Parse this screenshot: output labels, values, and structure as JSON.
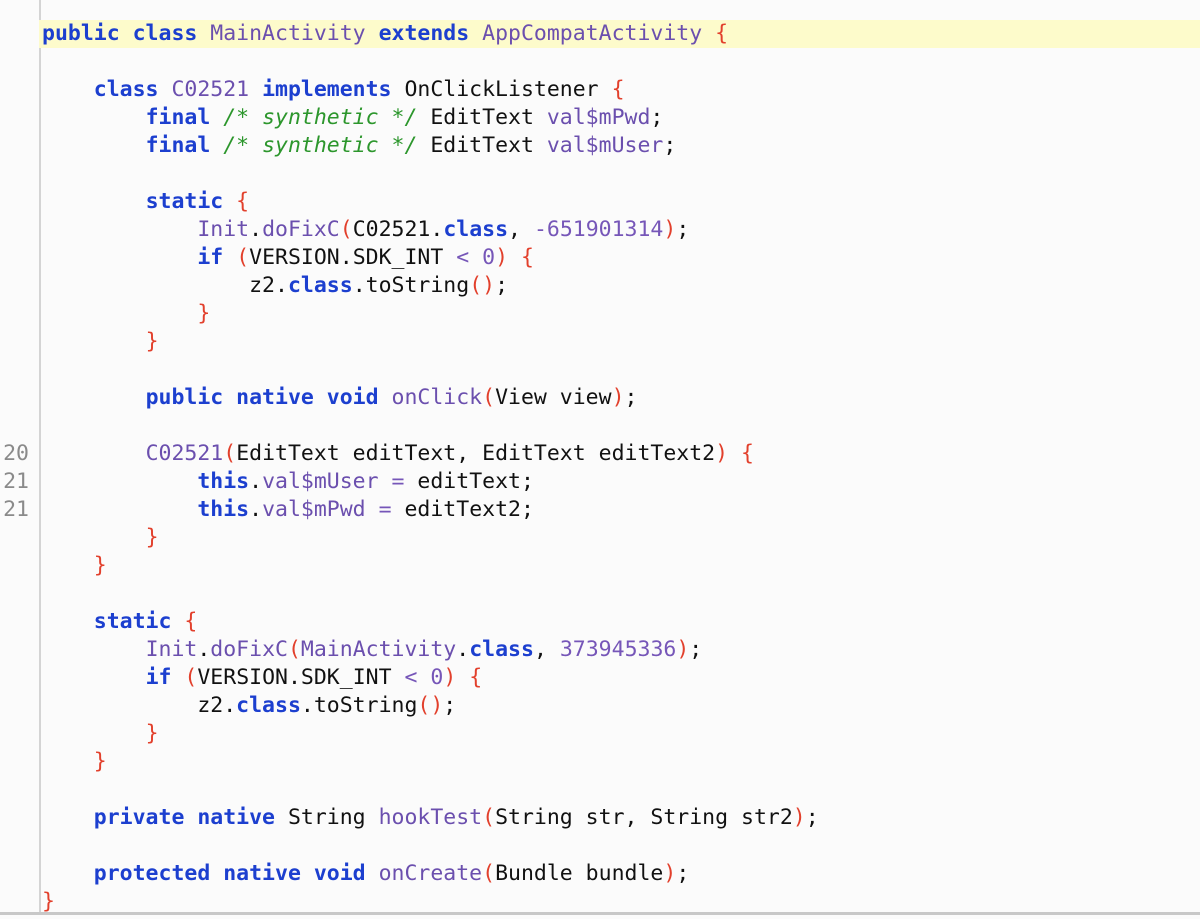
{
  "theme": {
    "keyword": "#1c3fcf",
    "identifier": "#6b4fae",
    "punctuation": "#e2402c",
    "comment": "#2c962c",
    "highlight": "#fdfbcb"
  },
  "code": {
    "highlighted_line": 0,
    "lines": [
      {
        "num": "",
        "tokens": [
          [
            "k",
            "public class "
          ],
          [
            "t",
            "MainActivity "
          ],
          [
            "k",
            "extends "
          ],
          [
            "t",
            "AppCompatActivity "
          ],
          [
            "p",
            "{"
          ]
        ]
      },
      {
        "num": "",
        "tokens": []
      },
      {
        "num": "",
        "tokens": [
          [
            "n",
            "    "
          ],
          [
            "k",
            "class "
          ],
          [
            "t",
            "C02521 "
          ],
          [
            "k",
            "implements "
          ],
          [
            "n",
            "OnClickListener "
          ],
          [
            "p",
            "{"
          ]
        ]
      },
      {
        "num": "",
        "tokens": [
          [
            "n",
            "        "
          ],
          [
            "k",
            "final "
          ],
          [
            "c",
            "/* synthetic */ "
          ],
          [
            "n",
            "EditText "
          ],
          [
            "t",
            "val$mPwd"
          ],
          [
            "n",
            ";"
          ]
        ]
      },
      {
        "num": "",
        "tokens": [
          [
            "n",
            "        "
          ],
          [
            "k",
            "final "
          ],
          [
            "c",
            "/* synthetic */ "
          ],
          [
            "n",
            "EditText "
          ],
          [
            "t",
            "val$mUser"
          ],
          [
            "n",
            ";"
          ]
        ]
      },
      {
        "num": "",
        "tokens": []
      },
      {
        "num": "",
        "tokens": [
          [
            "n",
            "        "
          ],
          [
            "k",
            "static "
          ],
          [
            "p",
            "{"
          ]
        ]
      },
      {
        "num": "",
        "tokens": [
          [
            "n",
            "            "
          ],
          [
            "t",
            "Init"
          ],
          [
            "n",
            "."
          ],
          [
            "t",
            "doFixC"
          ],
          [
            "p",
            "("
          ],
          [
            "n",
            "C02521."
          ],
          [
            "k",
            "class"
          ],
          [
            "n",
            ", "
          ],
          [
            "o",
            "-651901314"
          ],
          [
            "p",
            ")"
          ],
          [
            "n",
            ";"
          ]
        ]
      },
      {
        "num": "",
        "tokens": [
          [
            "n",
            "            "
          ],
          [
            "k",
            "if "
          ],
          [
            "p",
            "("
          ],
          [
            "n",
            "VERSION.SDK_INT "
          ],
          [
            "o",
            "< 0"
          ],
          [
            "p",
            ") {"
          ]
        ]
      },
      {
        "num": "",
        "tokens": [
          [
            "n",
            "                z2."
          ],
          [
            "k",
            "class"
          ],
          [
            "n",
            ".toString"
          ],
          [
            "p",
            "()"
          ],
          [
            "n",
            ";"
          ]
        ]
      },
      {
        "num": "",
        "tokens": [
          [
            "n",
            "            "
          ],
          [
            "p",
            "}"
          ]
        ]
      },
      {
        "num": "",
        "tokens": [
          [
            "n",
            "        "
          ],
          [
            "p",
            "}"
          ]
        ]
      },
      {
        "num": "",
        "tokens": []
      },
      {
        "num": "",
        "tokens": [
          [
            "n",
            "        "
          ],
          [
            "k",
            "public native void "
          ],
          [
            "t",
            "onClick"
          ],
          [
            "p",
            "("
          ],
          [
            "n",
            "View view"
          ],
          [
            "p",
            ")"
          ],
          [
            "n",
            ";"
          ]
        ]
      },
      {
        "num": "",
        "tokens": []
      },
      {
        "num": "20",
        "tokens": [
          [
            "n",
            "        "
          ],
          [
            "t",
            "C02521"
          ],
          [
            "p",
            "("
          ],
          [
            "n",
            "EditText editText, EditText editText2"
          ],
          [
            "p",
            ") {"
          ]
        ]
      },
      {
        "num": "21",
        "tokens": [
          [
            "n",
            "            "
          ],
          [
            "k",
            "this"
          ],
          [
            "n",
            "."
          ],
          [
            "t",
            "val$mUser "
          ],
          [
            "o",
            "= "
          ],
          [
            "n",
            "editText;"
          ]
        ]
      },
      {
        "num": "21",
        "tokens": [
          [
            "n",
            "            "
          ],
          [
            "k",
            "this"
          ],
          [
            "n",
            "."
          ],
          [
            "t",
            "val$mPwd "
          ],
          [
            "o",
            "= "
          ],
          [
            "n",
            "editText2;"
          ]
        ]
      },
      {
        "num": "",
        "tokens": [
          [
            "n",
            "        "
          ],
          [
            "p",
            "}"
          ]
        ]
      },
      {
        "num": "",
        "tokens": [
          [
            "n",
            "    "
          ],
          [
            "p",
            "}"
          ]
        ]
      },
      {
        "num": "",
        "tokens": []
      },
      {
        "num": "",
        "tokens": [
          [
            "n",
            "    "
          ],
          [
            "k",
            "static "
          ],
          [
            "p",
            "{"
          ]
        ]
      },
      {
        "num": "",
        "tokens": [
          [
            "n",
            "        "
          ],
          [
            "t",
            "Init"
          ],
          [
            "n",
            "."
          ],
          [
            "t",
            "doFixC"
          ],
          [
            "p",
            "("
          ],
          [
            "t",
            "MainActivity"
          ],
          [
            "n",
            "."
          ],
          [
            "k",
            "class"
          ],
          [
            "n",
            ", "
          ],
          [
            "o",
            "373945336"
          ],
          [
            "p",
            ")"
          ],
          [
            "n",
            ";"
          ]
        ]
      },
      {
        "num": "",
        "tokens": [
          [
            "n",
            "        "
          ],
          [
            "k",
            "if "
          ],
          [
            "p",
            "("
          ],
          [
            "n",
            "VERSION.SDK_INT "
          ],
          [
            "o",
            "< 0"
          ],
          [
            "p",
            ") {"
          ]
        ]
      },
      {
        "num": "",
        "tokens": [
          [
            "n",
            "            z2."
          ],
          [
            "k",
            "class"
          ],
          [
            "n",
            ".toString"
          ],
          [
            "p",
            "()"
          ],
          [
            "n",
            ";"
          ]
        ]
      },
      {
        "num": "",
        "tokens": [
          [
            "n",
            "        "
          ],
          [
            "p",
            "}"
          ]
        ]
      },
      {
        "num": "",
        "tokens": [
          [
            "n",
            "    "
          ],
          [
            "p",
            "}"
          ]
        ]
      },
      {
        "num": "",
        "tokens": []
      },
      {
        "num": "",
        "tokens": [
          [
            "n",
            "    "
          ],
          [
            "k",
            "private native "
          ],
          [
            "n",
            "String "
          ],
          [
            "t",
            "hookTest"
          ],
          [
            "p",
            "("
          ],
          [
            "n",
            "String str, String str2"
          ],
          [
            "p",
            ")"
          ],
          [
            "n",
            ";"
          ]
        ]
      },
      {
        "num": "",
        "tokens": []
      },
      {
        "num": "",
        "tokens": [
          [
            "n",
            "    "
          ],
          [
            "k",
            "protected native void "
          ],
          [
            "t",
            "onCreate"
          ],
          [
            "p",
            "("
          ],
          [
            "n",
            "Bundle bundle"
          ],
          [
            "p",
            ")"
          ],
          [
            "n",
            ";"
          ]
        ]
      },
      {
        "num": "",
        "tokens": [
          [
            "p",
            "}"
          ]
        ]
      }
    ]
  }
}
